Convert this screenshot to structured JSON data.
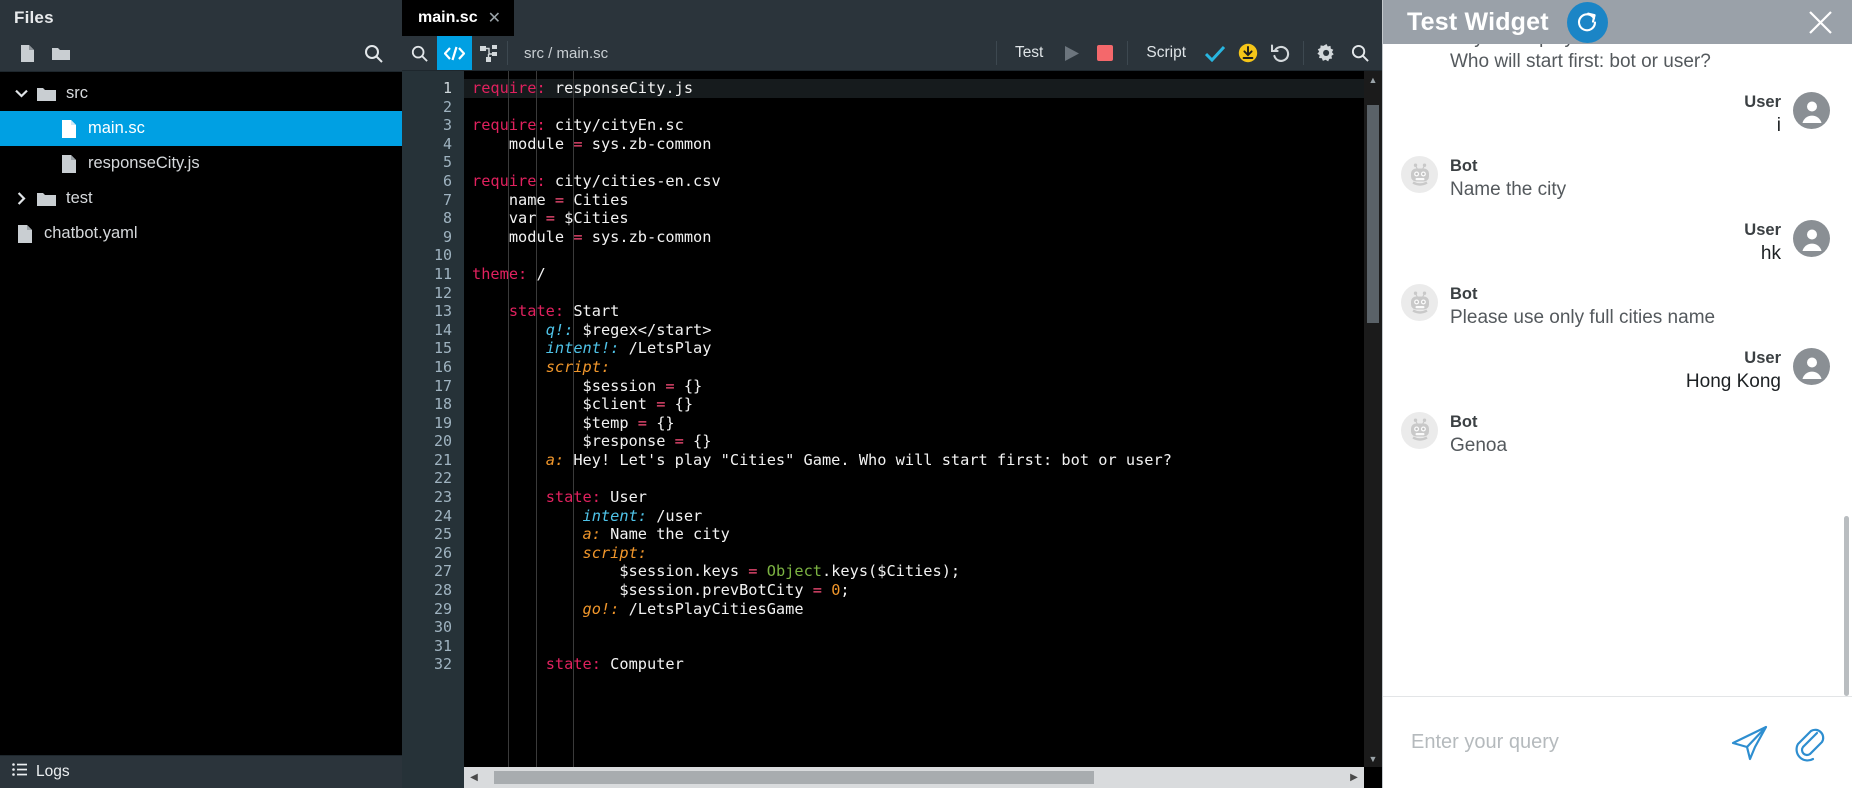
{
  "files_panel": {
    "title": "Files",
    "toolbar": {
      "new_file_icon": "file-icon",
      "new_folder_icon": "folder-icon",
      "search_icon": "search-icon"
    },
    "tree": [
      {
        "label": "src",
        "type": "folder",
        "indent": 0,
        "expanded": true,
        "selected": false
      },
      {
        "label": "main.sc",
        "type": "file",
        "indent": 1,
        "expanded": null,
        "selected": true
      },
      {
        "label": "responseCity.js",
        "type": "file",
        "indent": 1,
        "expanded": null,
        "selected": false
      },
      {
        "label": "test",
        "type": "folder",
        "indent": 0,
        "expanded": false,
        "selected": false
      },
      {
        "label": "chatbot.yaml",
        "type": "file",
        "indent": 0,
        "expanded": null,
        "selected": false
      }
    ],
    "logs_label": "Logs",
    "logs_icon": "list-icon"
  },
  "editor": {
    "tab": {
      "label": "main.sc",
      "close_icon": "close-icon"
    },
    "toolbar": {
      "search_icon": "search-icon",
      "code_view_icon": "code-brackets-icon",
      "graph_view_icon": "sitemap-icon",
      "breadcrumb": "src / main.sc",
      "test_label": "Test",
      "run_icon": "play-icon",
      "stop_icon": "stop-square-icon",
      "script_label": "Script",
      "validate_icon": "check-icon",
      "deploy_icon": "download-circle-icon",
      "revert_icon": "undo-icon",
      "settings_icon": "gear-icon",
      "find_icon": "search-icon"
    },
    "accent_color": "#00a0e3",
    "first_line": 1,
    "last_line": 32,
    "lines": [
      {
        "n": 1,
        "tokens": [
          {
            "t": "require:",
            "c": "k"
          },
          {
            "t": " responseCity.js",
            "c": "pl"
          }
        ]
      },
      {
        "n": 2,
        "tokens": []
      },
      {
        "n": 3,
        "tokens": [
          {
            "t": "require:",
            "c": "k"
          },
          {
            "t": " city/cityEn.sc",
            "c": "pl"
          }
        ]
      },
      {
        "n": 4,
        "tokens": [
          {
            "t": "    module ",
            "c": "pl"
          },
          {
            "t": "=",
            "c": "op"
          },
          {
            "t": " sys.zb-common",
            "c": "pl"
          }
        ]
      },
      {
        "n": 5,
        "tokens": []
      },
      {
        "n": 6,
        "tokens": [
          {
            "t": "require:",
            "c": "k"
          },
          {
            "t": " city/cities-en.csv",
            "c": "pl"
          }
        ]
      },
      {
        "n": 7,
        "tokens": [
          {
            "t": "    name ",
            "c": "pl"
          },
          {
            "t": "=",
            "c": "op"
          },
          {
            "t": " Cities",
            "c": "pl"
          }
        ]
      },
      {
        "n": 8,
        "tokens": [
          {
            "t": "    var ",
            "c": "pl"
          },
          {
            "t": "=",
            "c": "op"
          },
          {
            "t": " $Cities",
            "c": "pl"
          }
        ]
      },
      {
        "n": 9,
        "tokens": [
          {
            "t": "    module ",
            "c": "pl"
          },
          {
            "t": "=",
            "c": "op"
          },
          {
            "t": " sys.zb-common",
            "c": "pl"
          }
        ]
      },
      {
        "n": 10,
        "tokens": []
      },
      {
        "n": 11,
        "tokens": [
          {
            "t": "theme:",
            "c": "k"
          },
          {
            "t": " /",
            "c": "pl"
          }
        ]
      },
      {
        "n": 12,
        "tokens": []
      },
      {
        "n": 13,
        "tokens": [
          {
            "t": "    ",
            "c": "pl"
          },
          {
            "t": "state:",
            "c": "k"
          },
          {
            "t": " Start",
            "c": "pl"
          }
        ]
      },
      {
        "n": 14,
        "tokens": [
          {
            "t": "        ",
            "c": "pl"
          },
          {
            "t": "q!:",
            "c": "ki"
          },
          {
            "t": " $regex</start>",
            "c": "pl"
          }
        ]
      },
      {
        "n": 15,
        "tokens": [
          {
            "t": "        ",
            "c": "pl"
          },
          {
            "t": "intent!:",
            "c": "ki"
          },
          {
            "t": " /LetsPlay",
            "c": "pl"
          }
        ]
      },
      {
        "n": 16,
        "tokens": [
          {
            "t": "        ",
            "c": "pl"
          },
          {
            "t": "script:",
            "c": "ko"
          }
        ]
      },
      {
        "n": 17,
        "tokens": [
          {
            "t": "            $session ",
            "c": "pl"
          },
          {
            "t": "=",
            "c": "op"
          },
          {
            "t": " {}",
            "c": "pl"
          }
        ]
      },
      {
        "n": 18,
        "tokens": [
          {
            "t": "            $client ",
            "c": "pl"
          },
          {
            "t": "=",
            "c": "op"
          },
          {
            "t": " {}",
            "c": "pl"
          }
        ]
      },
      {
        "n": 19,
        "tokens": [
          {
            "t": "            $temp ",
            "c": "pl"
          },
          {
            "t": "=",
            "c": "op"
          },
          {
            "t": " {}",
            "c": "pl"
          }
        ]
      },
      {
        "n": 20,
        "tokens": [
          {
            "t": "            $response ",
            "c": "pl"
          },
          {
            "t": "=",
            "c": "op"
          },
          {
            "t": " {}",
            "c": "pl"
          }
        ]
      },
      {
        "n": 21,
        "tokens": [
          {
            "t": "        ",
            "c": "pl"
          },
          {
            "t": "a:",
            "c": "ko"
          },
          {
            "t": " Hey! Let's play \"Cities\" Game. Who will start first: bot or user?",
            "c": "pl"
          }
        ]
      },
      {
        "n": 22,
        "tokens": []
      },
      {
        "n": 23,
        "tokens": [
          {
            "t": "        ",
            "c": "pl"
          },
          {
            "t": "state:",
            "c": "k"
          },
          {
            "t": " User",
            "c": "pl"
          }
        ]
      },
      {
        "n": 24,
        "tokens": [
          {
            "t": "            ",
            "c": "pl"
          },
          {
            "t": "intent:",
            "c": "ki"
          },
          {
            "t": " /user",
            "c": "pl"
          }
        ]
      },
      {
        "n": 25,
        "tokens": [
          {
            "t": "            ",
            "c": "pl"
          },
          {
            "t": "a:",
            "c": "ko"
          },
          {
            "t": " Name the city",
            "c": "pl"
          }
        ]
      },
      {
        "n": 26,
        "tokens": [
          {
            "t": "            ",
            "c": "pl"
          },
          {
            "t": "script:",
            "c": "ko"
          }
        ]
      },
      {
        "n": 27,
        "tokens": [
          {
            "t": "                $session.keys ",
            "c": "pl"
          },
          {
            "t": "=",
            "c": "op"
          },
          {
            "t": " ",
            "c": "pl"
          },
          {
            "t": "Object",
            "c": "gr"
          },
          {
            "t": ".keys($Cities);",
            "c": "pl"
          }
        ]
      },
      {
        "n": 28,
        "tokens": [
          {
            "t": "                $session.prevBotCity ",
            "c": "pl"
          },
          {
            "t": "=",
            "c": "op"
          },
          {
            "t": " ",
            "c": "pl"
          },
          {
            "t": "0",
            "c": "num"
          },
          {
            "t": ";",
            "c": "pl"
          }
        ]
      },
      {
        "n": 29,
        "tokens": [
          {
            "t": "            ",
            "c": "pl"
          },
          {
            "t": "go!:",
            "c": "ko"
          },
          {
            "t": " /LetsPlayCitiesGame",
            "c": "pl"
          }
        ]
      },
      {
        "n": 30,
        "tokens": []
      },
      {
        "n": 31,
        "tokens": []
      },
      {
        "n": 32,
        "tokens": [
          {
            "t": "        ",
            "c": "pl"
          },
          {
            "t": "state:",
            "c": "k"
          },
          {
            "t": " Computer",
            "c": "pl"
          }
        ]
      }
    ]
  },
  "widget": {
    "title": "Test Widget",
    "refresh_icon": "refresh-icon",
    "close_icon": "close-icon",
    "bot_name": "Bot",
    "user_name": "User",
    "bot_avatar_icon": "robot-avatar-icon",
    "user_avatar_icon": "person-avatar-icon",
    "messages": [
      {
        "from": "bot",
        "who": "Bot",
        "text": "Hey! Let's play \"Cities\" Game. Who will start first: bot or user?"
      },
      {
        "from": "user",
        "who": "User",
        "text": "i"
      },
      {
        "from": "bot",
        "who": "Bot",
        "text": "Name the city"
      },
      {
        "from": "user",
        "who": "User",
        "text": "hk"
      },
      {
        "from": "bot",
        "who": "Bot",
        "text": "Please use only full cities name"
      },
      {
        "from": "user",
        "who": "User",
        "text": "Hong Kong"
      },
      {
        "from": "bot",
        "who": "Bot",
        "text": "Genoa"
      }
    ],
    "composer": {
      "placeholder": "Enter your query",
      "value": "",
      "send_icon": "send-plane-icon",
      "attach_icon": "paperclip-icon"
    },
    "accent_color": "#2e8ed0"
  }
}
